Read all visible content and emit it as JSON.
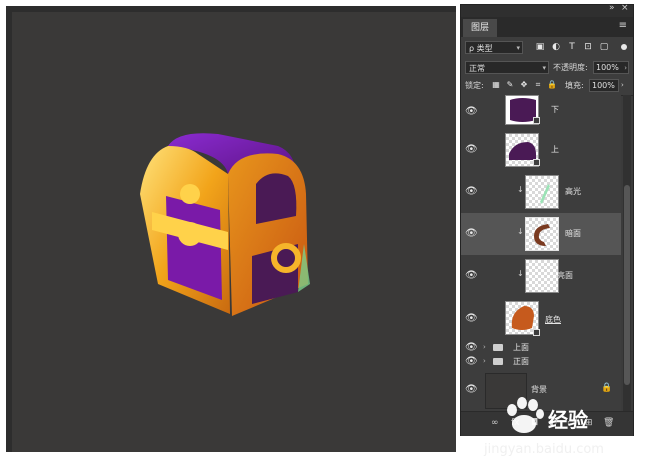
{
  "panel": {
    "tab_label": "图层",
    "collapse_glyph": "»",
    "close_glyph": "×",
    "menu_glyph": "≡",
    "filter": {
      "kind_label": "ρ 类型",
      "icons": [
        "image-filter-icon",
        "adjustment-filter-icon",
        "type-filter-icon",
        "shape-filter-icon",
        "smart-object-filter-icon"
      ]
    },
    "blend_mode": "正常",
    "opacity_label": "不透明度:",
    "opacity_value": "100%",
    "lock_label": "锁定:",
    "fill_label": "填充:",
    "fill_value": "100%"
  },
  "layers": [
    {
      "name": "下",
      "type": "layer",
      "thumb_color": "#4a1a55",
      "has_mask": true,
      "clipped": false,
      "selected": false
    },
    {
      "name": "上",
      "type": "layer",
      "thumb_color": "#4a1a55",
      "has_mask": true,
      "clipped": false,
      "selected": false
    },
    {
      "name": "高光",
      "type": "layer",
      "thumb_color": "#9be3b6",
      "has_mask": false,
      "clipped": true,
      "selected": false
    },
    {
      "name": "暗面",
      "type": "layer",
      "thumb_color": "#7a3a20",
      "has_mask": false,
      "clipped": true,
      "selected": true
    },
    {
      "name": "亮面",
      "type": "layer",
      "thumb_color": "#ffffff",
      "has_mask": false,
      "clipped": true,
      "selected": false
    },
    {
      "name": "底色",
      "type": "layer",
      "thumb_color": "#c65a1d",
      "has_mask": true,
      "clipped": false,
      "selected": false
    },
    {
      "name": "上面",
      "type": "group"
    },
    {
      "name": "正面",
      "type": "group"
    },
    {
      "name": "背景",
      "type": "background",
      "thumb_color": "#3a3938"
    }
  ],
  "bottom_icons": [
    "link-icon",
    "fx-icon",
    "mask-icon",
    "adjustment-icon",
    "group-icon",
    "new-layer-icon",
    "delete-icon"
  ],
  "watermark": {
    "text": "经验",
    "url": "jingyan.baidu.com"
  },
  "colors": {
    "canvas": "#3a3938",
    "panel": "#3d3d3d",
    "selected_layer": "#555555",
    "chest_purple": "#6a1a9a",
    "chest_gold": "#f2a41a"
  }
}
